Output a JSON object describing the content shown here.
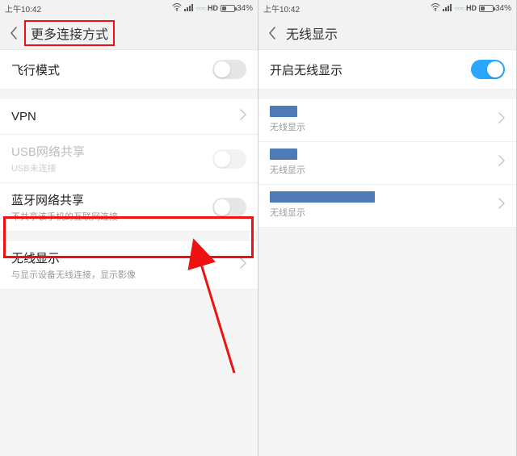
{
  "status": {
    "time": "上午10:42",
    "hd": "HD",
    "battery_pct": "34%"
  },
  "left": {
    "title": "更多连接方式",
    "rows": {
      "airplane": {
        "label": "飞行模式"
      },
      "vpn": {
        "label": "VPN"
      },
      "usb_tether": {
        "label": "USB网络共享",
        "sub": "USB未连接"
      },
      "bt_tether": {
        "label": "蓝牙网络共享",
        "sub": "不共享该手机的互联网连接"
      },
      "wireless_display": {
        "label": "无线显示",
        "sub": "与显示设备无线连接，显示影像"
      }
    }
  },
  "right": {
    "title": "无线显示",
    "enable_label": "开启无线显示",
    "device_sub": "无线显示"
  }
}
